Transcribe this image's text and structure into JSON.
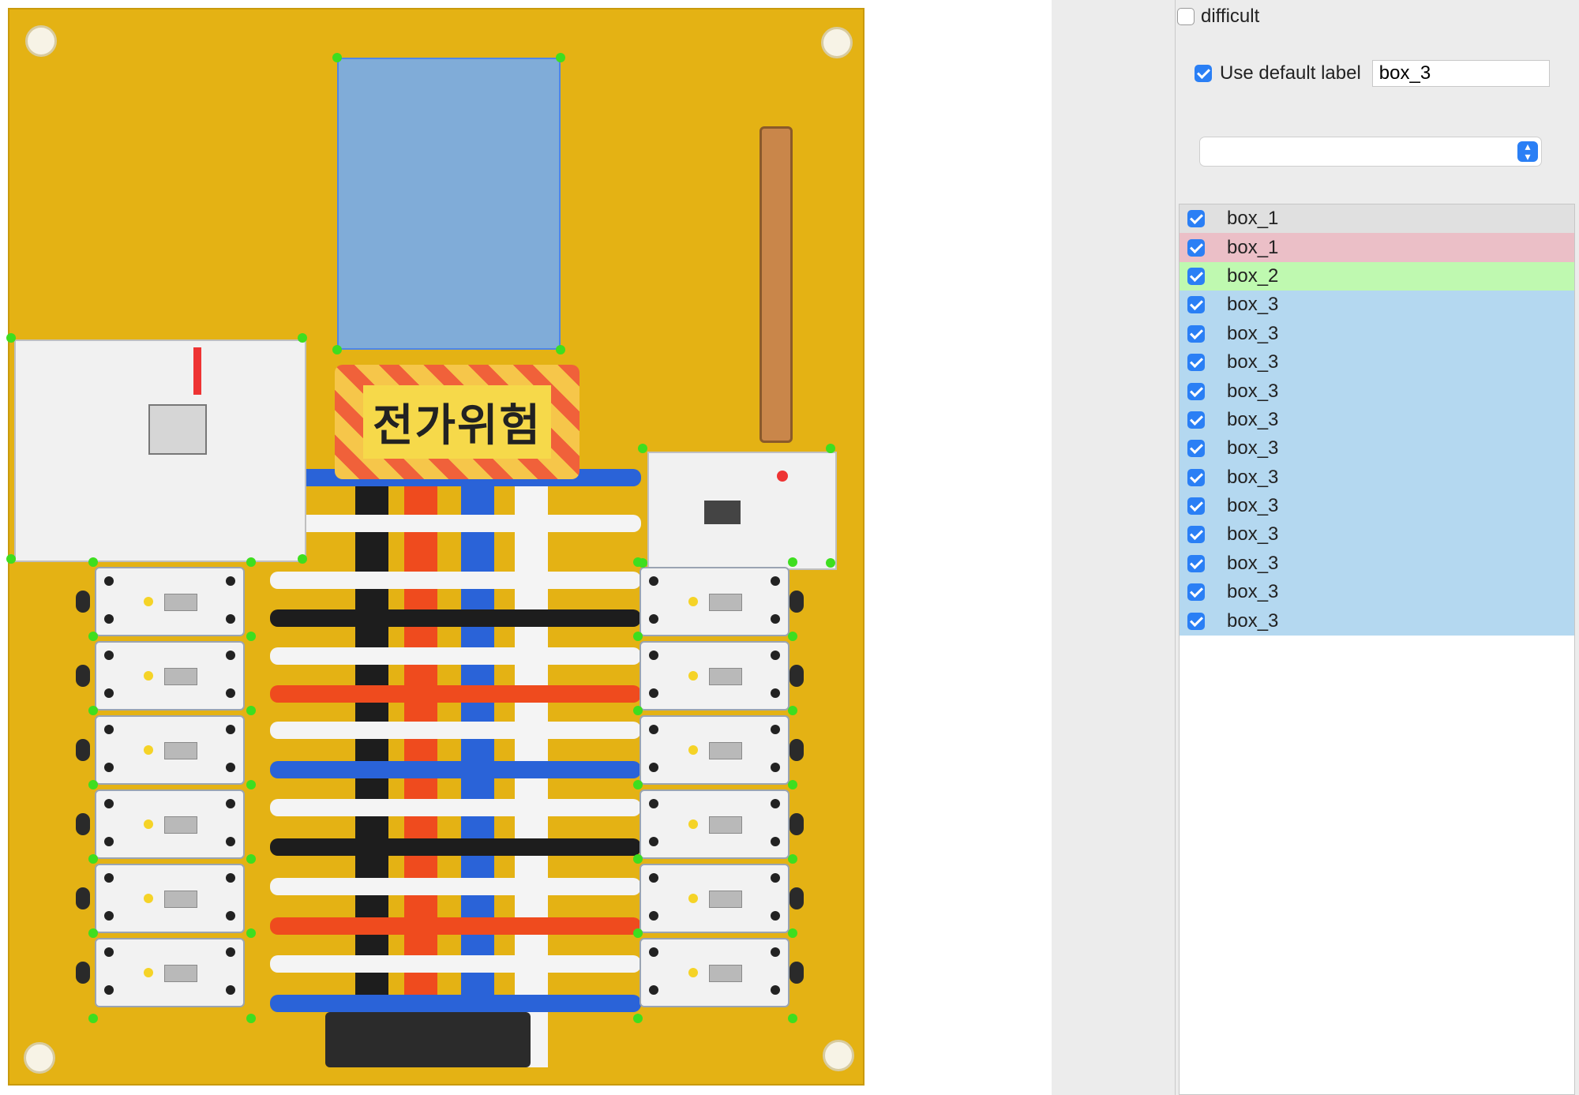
{
  "panel": {
    "difficult": {
      "label": "difficult",
      "checked": false
    },
    "default_label": {
      "label": "Use default label",
      "checked": true,
      "value": "box_3"
    },
    "dropdown": {
      "value": ""
    },
    "labels": [
      {
        "text": "box_1",
        "checked": true,
        "color": "#e0e0e0"
      },
      {
        "text": "box_1",
        "checked": true,
        "color": "#ebbfc7"
      },
      {
        "text": "box_2",
        "checked": true,
        "color": "#bff9b0"
      },
      {
        "text": "box_3",
        "checked": true,
        "color": "#b4d8f0"
      },
      {
        "text": "box_3",
        "checked": true,
        "color": "#b4d8f0"
      },
      {
        "text": "box_3",
        "checked": true,
        "color": "#b4d8f0"
      },
      {
        "text": "box_3",
        "checked": true,
        "color": "#b4d8f0"
      },
      {
        "text": "box_3",
        "checked": true,
        "color": "#b4d8f0"
      },
      {
        "text": "box_3",
        "checked": true,
        "color": "#b4d8f0"
      },
      {
        "text": "box_3",
        "checked": true,
        "color": "#b4d8f0"
      },
      {
        "text": "box_3",
        "checked": true,
        "color": "#b4d8f0"
      },
      {
        "text": "box_3",
        "checked": true,
        "color": "#b4d8f0"
      },
      {
        "text": "box_3",
        "checked": true,
        "color": "#b4d8f0"
      },
      {
        "text": "box_3",
        "checked": true,
        "color": "#b4d8f0"
      },
      {
        "text": "box_3",
        "checked": true,
        "color": "#b4d8f0"
      }
    ]
  },
  "image": {
    "warning_sign_text": "전가위험"
  },
  "colors": {
    "board": "#e4b214",
    "selection_fill": "#6eaafa",
    "handle": "#3ede1f"
  }
}
